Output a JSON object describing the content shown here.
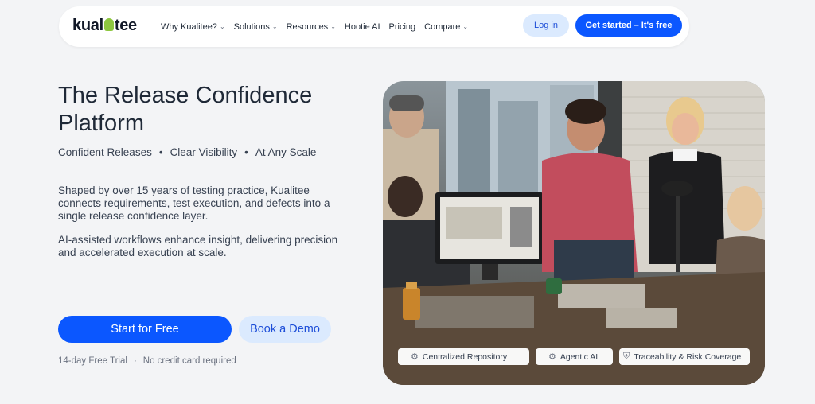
{
  "nav": {
    "logo": "kualitee",
    "items": [
      {
        "label": "Why Kualitee?",
        "has_dropdown": true
      },
      {
        "label": "Solutions",
        "has_dropdown": true
      },
      {
        "label": "Resources",
        "has_dropdown": true
      },
      {
        "label": "Hootie AI",
        "has_dropdown": false
      },
      {
        "label": "Pricing",
        "has_dropdown": false
      },
      {
        "label": "Compare",
        "has_dropdown": true
      }
    ],
    "login_label": "Log in",
    "start_label": "Get started – It's free"
  },
  "hero": {
    "title": "The Release Confidence Platform",
    "pillars": [
      "Confident Releases",
      "Clear Visibility",
      "At Any Scale"
    ],
    "paragraph_1": "Shaped by over 15 years of testing practice, Kualitee connects requirements, test execution, and defects into a single release confidence layer.",
    "paragraph_2": "AI-assisted workflows enhance insight, delivering precision and accelerated execution at scale.",
    "cta_primary": "Start for Free",
    "cta_secondary": "Book a Demo",
    "trial_note": [
      "14-day Free Trial",
      "No credit card required"
    ],
    "image_badges": [
      {
        "label": "Centralized Repository",
        "icon": "gear-icon"
      },
      {
        "label": "Agentic AI",
        "icon": "gear-icon"
      },
      {
        "label": "Traceability & Risk Coverage",
        "icon": "shield-icon"
      }
    ]
  },
  "colors": {
    "accent": "#0b57ff",
    "accent_soft": "#dbeafe",
    "background": "#f3f4f6",
    "logo_owl": "#8dc63f"
  }
}
